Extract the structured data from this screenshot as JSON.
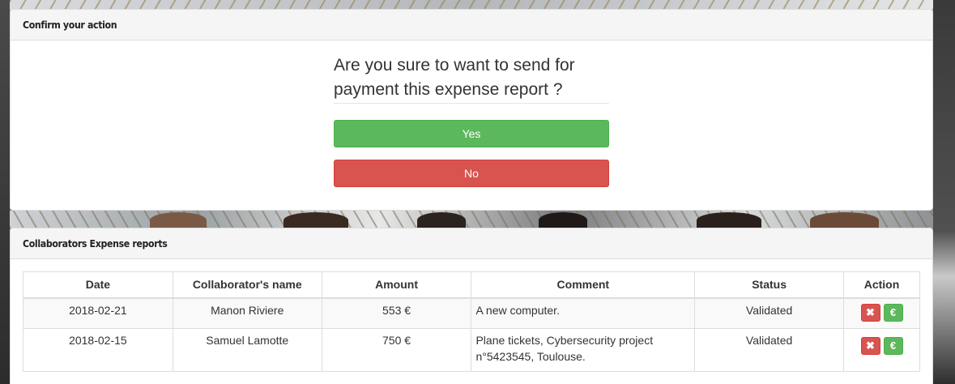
{
  "confirm_dialog": {
    "title": "Confirm your action",
    "question": "Are you sure to want to send for payment this expense report ?",
    "yes_label": "Yes",
    "no_label": "No"
  },
  "reports": {
    "title": "Collaborators Expense reports",
    "columns": [
      "Date",
      "Collaborator's name",
      "Amount",
      "Comment",
      "Status",
      "Action"
    ],
    "rows": [
      {
        "date": "2018-02-21",
        "name": "Manon Riviere",
        "amount": "553 €",
        "comment": "A new computer.",
        "status": "Validated",
        "delete_icon": "✖",
        "pay_icon": "€"
      },
      {
        "date": "2018-02-15",
        "name": "Samuel Lamotte",
        "amount": "750 €",
        "comment": "Plane tickets, Cybersecurity project n°5423545, Toulouse.",
        "status": "Validated",
        "delete_icon": "✖",
        "pay_icon": "€"
      }
    ]
  },
  "colors": {
    "success": "#5cb85c",
    "danger": "#d9534f",
    "panel_heading_bg": "#f5f5f5"
  }
}
